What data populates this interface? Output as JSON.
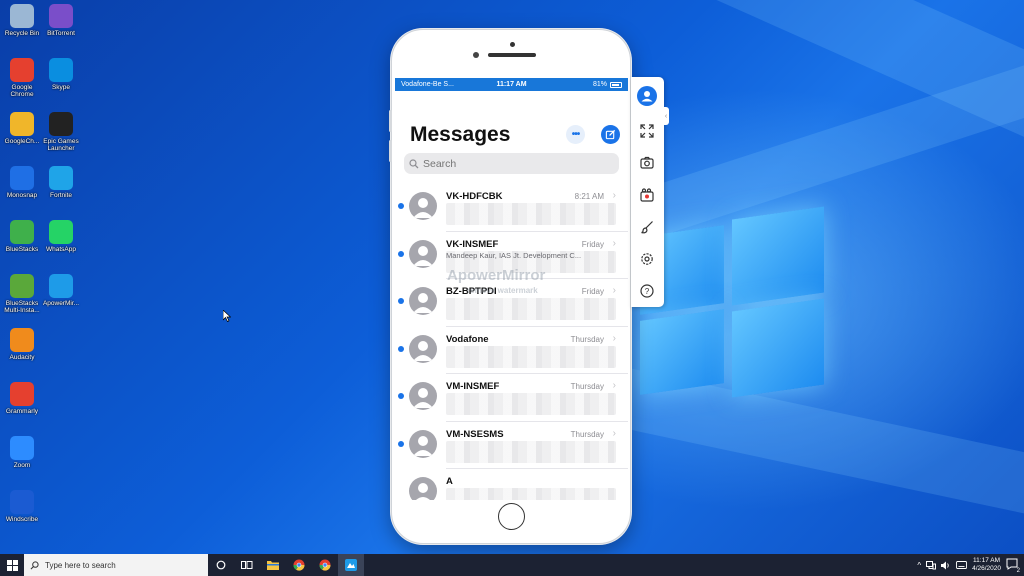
{
  "desktop": {
    "icons": [
      {
        "label": "Recycle Bin",
        "icon": "recycle-bin-icon",
        "color": "#9bb7d4"
      },
      {
        "label": "BitTorrent",
        "icon": "bittorrent-icon",
        "color": "#7a4ec9"
      },
      {
        "label": "Google Chrome",
        "icon": "chrome-icon",
        "color": "#e5402f"
      },
      {
        "label": "Skype",
        "icon": "skype-icon",
        "color": "#0a8ee0"
      },
      {
        "label": "GoogleCh...",
        "icon": "google-chrome-doc-icon",
        "color": "#f0b62a"
      },
      {
        "label": "Epic Games Launcher",
        "icon": "epic-games-icon",
        "color": "#222222"
      },
      {
        "label": "Monosnap",
        "icon": "monosnap-icon",
        "color": "#1f6fe5"
      },
      {
        "label": "Fortnite",
        "icon": "fortnite-icon",
        "color": "#1fa4e8"
      },
      {
        "label": "BlueStacks",
        "icon": "bluestacks-icon",
        "color": "#3fb04b"
      },
      {
        "label": "WhatsApp",
        "icon": "whatsapp-icon",
        "color": "#25d366"
      },
      {
        "label": "BlueStacks Multi-Insta...",
        "icon": "bluestacks-multi-icon",
        "color": "#5aa83a"
      },
      {
        "label": "ApowerMir...",
        "icon": "apowermirror-icon",
        "color": "#1e9be8"
      },
      {
        "label": "Audacity",
        "icon": "audacity-icon",
        "color": "#f08b1c"
      },
      {
        "label": "Grammarly",
        "icon": "grammarly-chrome-icon",
        "color": "#e5402f"
      },
      {
        "label": "Zoom",
        "icon": "zoom-icon",
        "color": "#2d8cff"
      },
      {
        "label": "Windscribe",
        "icon": "windscribe-icon",
        "color": "#1b5bd2"
      }
    ]
  },
  "phone": {
    "status": {
      "carrier": "Vodafone-Be S...",
      "time": "11:17 AM",
      "battery": "81%"
    },
    "title": "Messages",
    "search_placeholder": "Search",
    "watermark": "ApowerMirror",
    "watermark_sub": "remove watermark",
    "messages": [
      {
        "sender": "VK-HDFCBK",
        "date": "8:21 AM",
        "preview": ""
      },
      {
        "sender": "VK-INSMEF",
        "date": "Friday",
        "preview": "Mandeep Kaur, IAS Jt. Development C..."
      },
      {
        "sender": "BZ-BPTPDI",
        "date": "Friday",
        "preview": ""
      },
      {
        "sender": "Vodafone",
        "date": "Thursday",
        "preview": ""
      },
      {
        "sender": "VM-INSMEF",
        "date": "Thursday",
        "preview": ""
      },
      {
        "sender": "VM-NSESMS",
        "date": "Thursday",
        "preview": ""
      },
      {
        "sender": "A",
        "date": "",
        "preview": ""
      }
    ]
  },
  "toolbar": {
    "buttons": [
      "profile-icon",
      "fullscreen-icon",
      "screenshot-icon",
      "record-icon",
      "brush-icon",
      "settings-icon",
      "help-icon"
    ]
  },
  "taskbar": {
    "search_placeholder": "Type here to search",
    "clock_time": "11:17 AM",
    "clock_date": "4/26/2020",
    "notifications": "2"
  }
}
